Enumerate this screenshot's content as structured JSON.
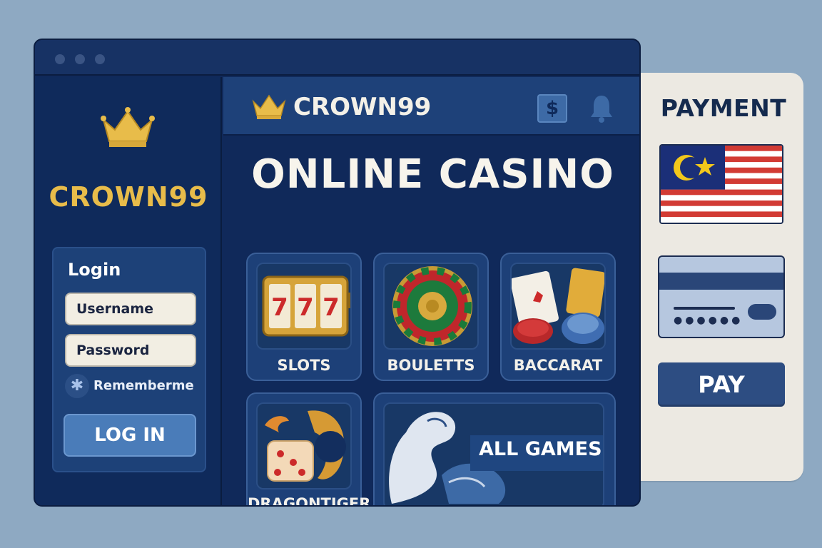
{
  "colors": {
    "background": "#8ea9c2",
    "window": "#10295a",
    "accent_gold": "#e8bc4a",
    "panel": "#ece9e2",
    "button_blue": "#4a7cb9",
    "flag_red": "#d23b34",
    "flag_blue": "#1b2f78",
    "flag_yellow": "#f3c81b"
  },
  "sidebar": {
    "logo_icon": "crown-icon",
    "logo_text": "CROWN99",
    "login": {
      "title": "Login",
      "username_placeholder": "Username",
      "password_placeholder": "Password",
      "remember_label": "Rememberme",
      "remember_icon": "asterisk-icon",
      "submit_label": "LOG IN"
    }
  },
  "header": {
    "brand_icon": "crown-icon",
    "brand": "CROWN99",
    "dollar_icon": "$",
    "bell_icon": "bell-icon"
  },
  "main": {
    "hero_title": "ONLINE CASINO",
    "games": [
      {
        "label": "SLOTS",
        "icon": "slot-machine-icon"
      },
      {
        "label": "BOULETTS",
        "icon": "roulette-wheel-icon"
      },
      {
        "label": "BACCARAT",
        "icon": "cards-and-chips-icon"
      },
      {
        "label": "DRAGONTIGER",
        "icon": "dragon-dice-icon"
      },
      {
        "label": "ALL GAMES",
        "icon": "dragon-tiger-art-icon"
      }
    ]
  },
  "payment": {
    "title": "PAYMENT",
    "flag_icon": "malaysia-flag-icon",
    "card_icon": "credit-card-icon",
    "pay_label": "PAY"
  }
}
